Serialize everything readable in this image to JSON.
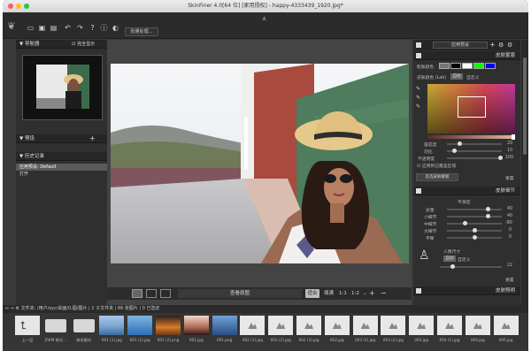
{
  "window": {
    "title": "SkinFiner 4.0[64 位] [家用授权] - happy-4333439_1920.jpg*"
  },
  "toolbar": {
    "batch_button": "批量处理..."
  },
  "navigator": {
    "title": "导航器",
    "fit_label": "完全显示"
  },
  "presets": {
    "title": "预设"
  },
  "history": {
    "title": "历史记录",
    "items": [
      "应用预设: Default",
      "打开"
    ]
  },
  "view": {
    "zoom_label": "查看原图",
    "fit_button": "适合",
    "fill_label": "填满",
    "ratio_1": "1:1",
    "ratio_2": "1:2"
  },
  "right": {
    "preset_dropdown": "应用预设",
    "skin_mask": {
      "title": "皮肤蒙版",
      "skin_color_label": "肌肤颜色",
      "color_space_label": "皮肤颜色 (Lab)",
      "color_space_btn": "自动",
      "custom_label": "自定义",
      "sliders": [
        {
          "label": "容忍度",
          "value": "20"
        },
        {
          "label": "羽化",
          "value": "10"
        },
        {
          "label": "不透明度",
          "value": "100"
        }
      ],
      "checkbox_label": "应用到已覆盖区域",
      "reset_button": "重置",
      "mode_button": "反选皮肤蒙版"
    },
    "skin_detail": {
      "title": "皮肤细节",
      "sublabel": "平滑度",
      "sliders": [
        {
          "label": "总量",
          "value": "40"
        },
        {
          "label": "小细节",
          "value": "40"
        },
        {
          "label": "中细节",
          "value": "-80"
        },
        {
          "label": "大细节",
          "value": "0"
        },
        {
          "label": "平衡",
          "value": "0"
        }
      ],
      "person_label": "人像尺寸",
      "auto_btn": "自动",
      "custom_label": "自定义",
      "size_value": "22",
      "reset_button": "重置"
    },
    "skin_lighting": {
      "title": "皮肤照明"
    },
    "swatch_colors": [
      "#000000",
      "#ffffff",
      "#00ff00",
      "#0000ff"
    ]
  },
  "pathbar": {
    "text": "文件夹: /用户/zyc/桌面/0,图/图片 | 2 子文件夹 | 66 张图片 | 0 已选定"
  },
  "filmstrip": {
    "items": [
      {
        "label": "上一层",
        "kind": "up"
      },
      {
        "label": "[RKM 格式...",
        "kind": "folder"
      },
      {
        "label": "梳毛素材",
        "kind": "folder"
      },
      {
        "label": "001 (1).jpg",
        "kind": "photo1"
      },
      {
        "label": "001 (2).jpg",
        "kind": "photo2"
      },
      {
        "label": "001 (2).png",
        "kind": "photo3"
      },
      {
        "label": "001.jpg",
        "kind": "photo4"
      },
      {
        "label": "001.png",
        "kind": "photo5"
      },
      {
        "label": "002 (1).jpg",
        "kind": "generic"
      },
      {
        "label": "002 (2).jpg",
        "kind": "generic"
      },
      {
        "label": "002 (3).jpg",
        "kind": "generic"
      },
      {
        "label": "002.jpg",
        "kind": "generic"
      },
      {
        "label": "003 (1).jpg",
        "kind": "generic"
      },
      {
        "label": "003 (2).jpg",
        "kind": "generic"
      },
      {
        "label": "003.jpg",
        "kind": "generic"
      },
      {
        "label": "004 (1).jpg",
        "kind": "generic"
      },
      {
        "label": "004.jpg",
        "kind": "generic"
      },
      {
        "label": "005.jpg",
        "kind": "generic"
      }
    ]
  }
}
